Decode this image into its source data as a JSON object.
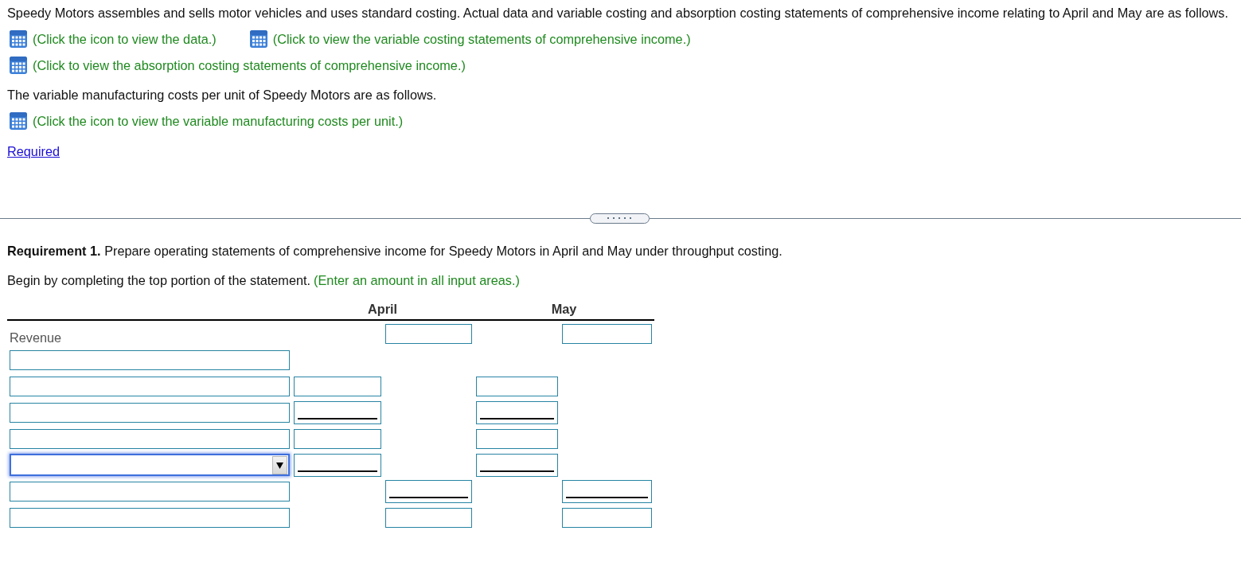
{
  "intro": [
    {
      "kind": "text",
      "text": "Speedy Motors assembles and sells motor vehicles and uses standard costing. Actual data and variable costing and absorption costing statements of comprehensive income relating to April and May are as follows."
    },
    {
      "kind": "links",
      "links": [
        "(Click the icon to view the data.)",
        "(Click to view the variable costing statements of comprehensive income.)"
      ]
    },
    {
      "kind": "links",
      "links": [
        "(Click to view the absorption costing statements of comprehensive income.)"
      ]
    },
    {
      "kind": "text",
      "text": "The variable manufacturing costs per unit of Speedy Motors are as follows."
    },
    {
      "kind": "links",
      "links": [
        "(Click the icon to view the variable manufacturing costs per unit.)"
      ]
    }
  ],
  "required_link": "Required",
  "requirement": "**Requirement 1.** Prepare operating statements of comprehensive income for Speedy Motors in April and May under throughput costing.",
  "instruction": {
    "text": "Begin by completing the top portion of the statement.",
    "hint": "(Enter an amount in all input areas.)"
  },
  "statement": {
    "columns": [
      "April",
      "May"
    ],
    "rows": [
      {
        "label": {
          "kind": "text",
          "text": "Revenue"
        },
        "april_total": {
          "total_line": false
        },
        "may_total": {
          "total_line": false
        }
      },
      {
        "label": {
          "kind": "field"
        }
      },
      {
        "label": {
          "kind": "field"
        },
        "april_detail": {
          "total_line": false
        },
        "may_detail": {
          "total_line": false
        }
      },
      {
        "label": {
          "kind": "field"
        },
        "april_detail": {
          "total_line": true
        },
        "may_detail": {
          "total_line": true
        }
      },
      {
        "label": {
          "kind": "field"
        },
        "april_detail": {
          "total_line": false
        },
        "may_detail": {
          "total_line": false
        }
      },
      {
        "label": {
          "kind": "dropdown",
          "focused": true
        },
        "april_detail": {
          "total_line": true
        },
        "may_detail": {
          "total_line": true
        }
      },
      {
        "label": {
          "kind": "field"
        },
        "april_total": {
          "total_line": true
        },
        "may_total": {
          "total_line": true
        }
      },
      {
        "label": {
          "kind": "field"
        },
        "april_total": {
          "total_line": false
        },
        "may_total": {
          "total_line": false
        }
      }
    ]
  }
}
